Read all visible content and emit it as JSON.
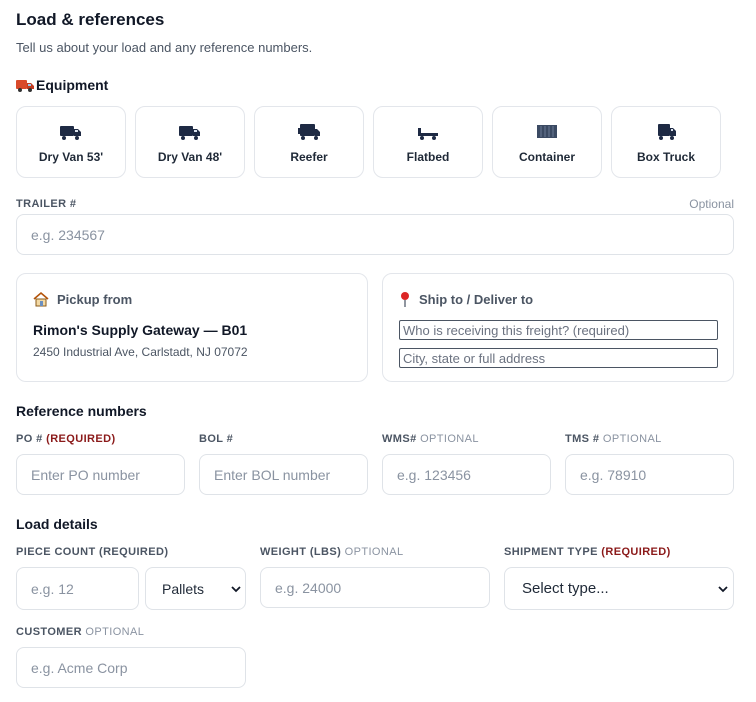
{
  "header": {
    "title": "Load & references",
    "subtitle": "Tell us about your load and any reference numbers."
  },
  "equipment": {
    "title": "Equipment",
    "options": [
      {
        "label": "Dry Van 53'",
        "icon": "truck-icon"
      },
      {
        "label": "Dry Van 48'",
        "icon": "truck-icon"
      },
      {
        "label": "Reefer",
        "icon": "reefer-truck-icon"
      },
      {
        "label": "Flatbed",
        "icon": "flatbed-icon"
      },
      {
        "label": "Container",
        "icon": "container-icon"
      },
      {
        "label": "Box Truck",
        "icon": "box-truck-icon"
      }
    ]
  },
  "trailer": {
    "label": "TRAILER #",
    "optional": "Optional",
    "placeholder": "e.g. 234567"
  },
  "pickup": {
    "title": "Pickup from",
    "icon": "house-icon",
    "name": "Rimon's Supply Gateway — B01",
    "address": "2450 Industrial Ave, Carlstadt, NJ 07072"
  },
  "shipto": {
    "title": "Ship to / Deliver to",
    "icon": "pin-icon",
    "receiver_placeholder": "Who is receiving this freight? (required)",
    "address_placeholder": "City, state or full address"
  },
  "references": {
    "title": "Reference numbers",
    "po": {
      "label": "PO #",
      "tag": "(REQUIRED)",
      "placeholder": "Enter PO number"
    },
    "bol": {
      "label": "BOL #",
      "placeholder": "Enter BOL number"
    },
    "wms": {
      "label": "WMS#",
      "tag": "OPTIONAL",
      "placeholder": "e.g. 123456"
    },
    "tms": {
      "label": "TMS #",
      "tag": "OPTIONAL",
      "placeholder": "e.g. 78910"
    }
  },
  "load_details": {
    "title": "Load details",
    "piece_count": {
      "label": "PIECE COUNT (REQUIRED)",
      "placeholder": "e.g. 12",
      "unit_selected": "Pallets"
    },
    "weight": {
      "label": "WEIGHT (LBS)",
      "tag": "OPTIONAL",
      "placeholder": "e.g. 24000"
    },
    "shipment_type": {
      "label": "SHIPMENT TYPE",
      "tag": "(REQUIRED)",
      "selected": "Select type..."
    },
    "customer": {
      "label": "CUSTOMER",
      "tag": "OPTIONAL",
      "placeholder": "e.g. Acme Corp"
    }
  },
  "colors": {
    "accent_required": "#8b1a1a",
    "icon_navy": "#1e2a44",
    "truck_red": "#d94a2b"
  }
}
